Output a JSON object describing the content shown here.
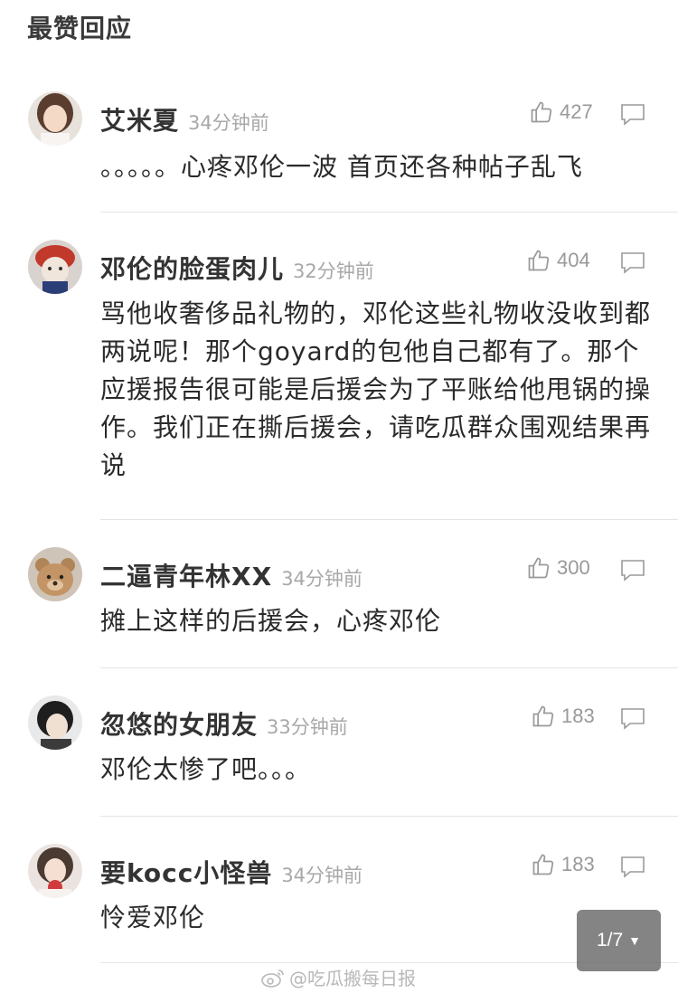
{
  "section": {
    "title": "最赞回应"
  },
  "comments": [
    {
      "username": "艾米夏",
      "time": "34分钟前",
      "likes": "427",
      "text": "。。。。。心疼邓伦一波 首页还各种帖子乱飞"
    },
    {
      "username": "邓伦的脸蛋肉儿",
      "time": "32分钟前",
      "likes": "404",
      "text": "骂他收奢侈品礼物的，邓伦这些礼物收没收到都两说呢！那个goyard的包他自己都有了。那个应援报告很可能是后援会为了平账给他甩锅的操作。我们正在撕后援会，请吃瓜群众围观结果再说"
    },
    {
      "username": "二逼青年林XX",
      "time": "34分钟前",
      "likes": "300",
      "text": "摊上这样的后援会，心疼邓伦"
    },
    {
      "username": "忽悠的女朋友",
      "time": "33分钟前",
      "likes": "183",
      "text": "邓伦太惨了吧。。。"
    },
    {
      "username": "要kocc小怪兽",
      "time": "34分钟前",
      "likes": "183",
      "text": "怜爱邓伦"
    }
  ],
  "pagination": {
    "label": "1/7"
  },
  "watermark": {
    "text": "@吃瓜搬每日报"
  },
  "icons": {
    "like": "thumbs-up-icon",
    "reply": "comment-bubble-icon",
    "watermark": "weibo-logo-icon"
  }
}
